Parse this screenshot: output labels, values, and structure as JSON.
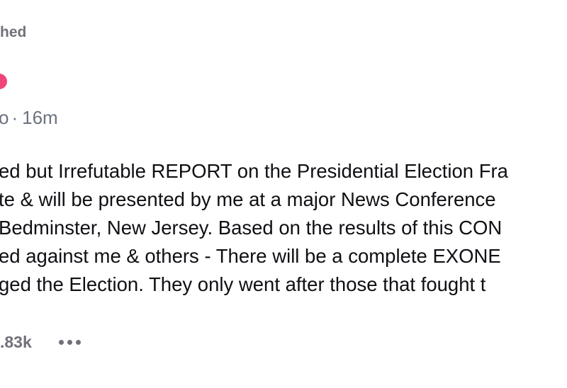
{
  "header": {
    "pinned_label": "hed"
  },
  "post": {
    "meta": {
      "handle_fragment": "o",
      "separator": "·",
      "time": "16m"
    },
    "lines": [
      "ed but Irrefutable REPORT on the Presidential Election Fra",
      "te & will be presented by me at a major News Conference",
      "Bedminster, New Jersey. Based on the results of this CON",
      "ed against me & others - There will be a complete EXONE",
      "ged the Election. They only went after those that fought t"
    ],
    "actions": {
      "like_count": ".83k"
    }
  },
  "colors": {
    "badge": "#f0457a",
    "muted": "#71717a",
    "text": "#0f0f14"
  },
  "icons": {
    "badge": "verified-badge-icon",
    "more": "more-options-icon"
  }
}
